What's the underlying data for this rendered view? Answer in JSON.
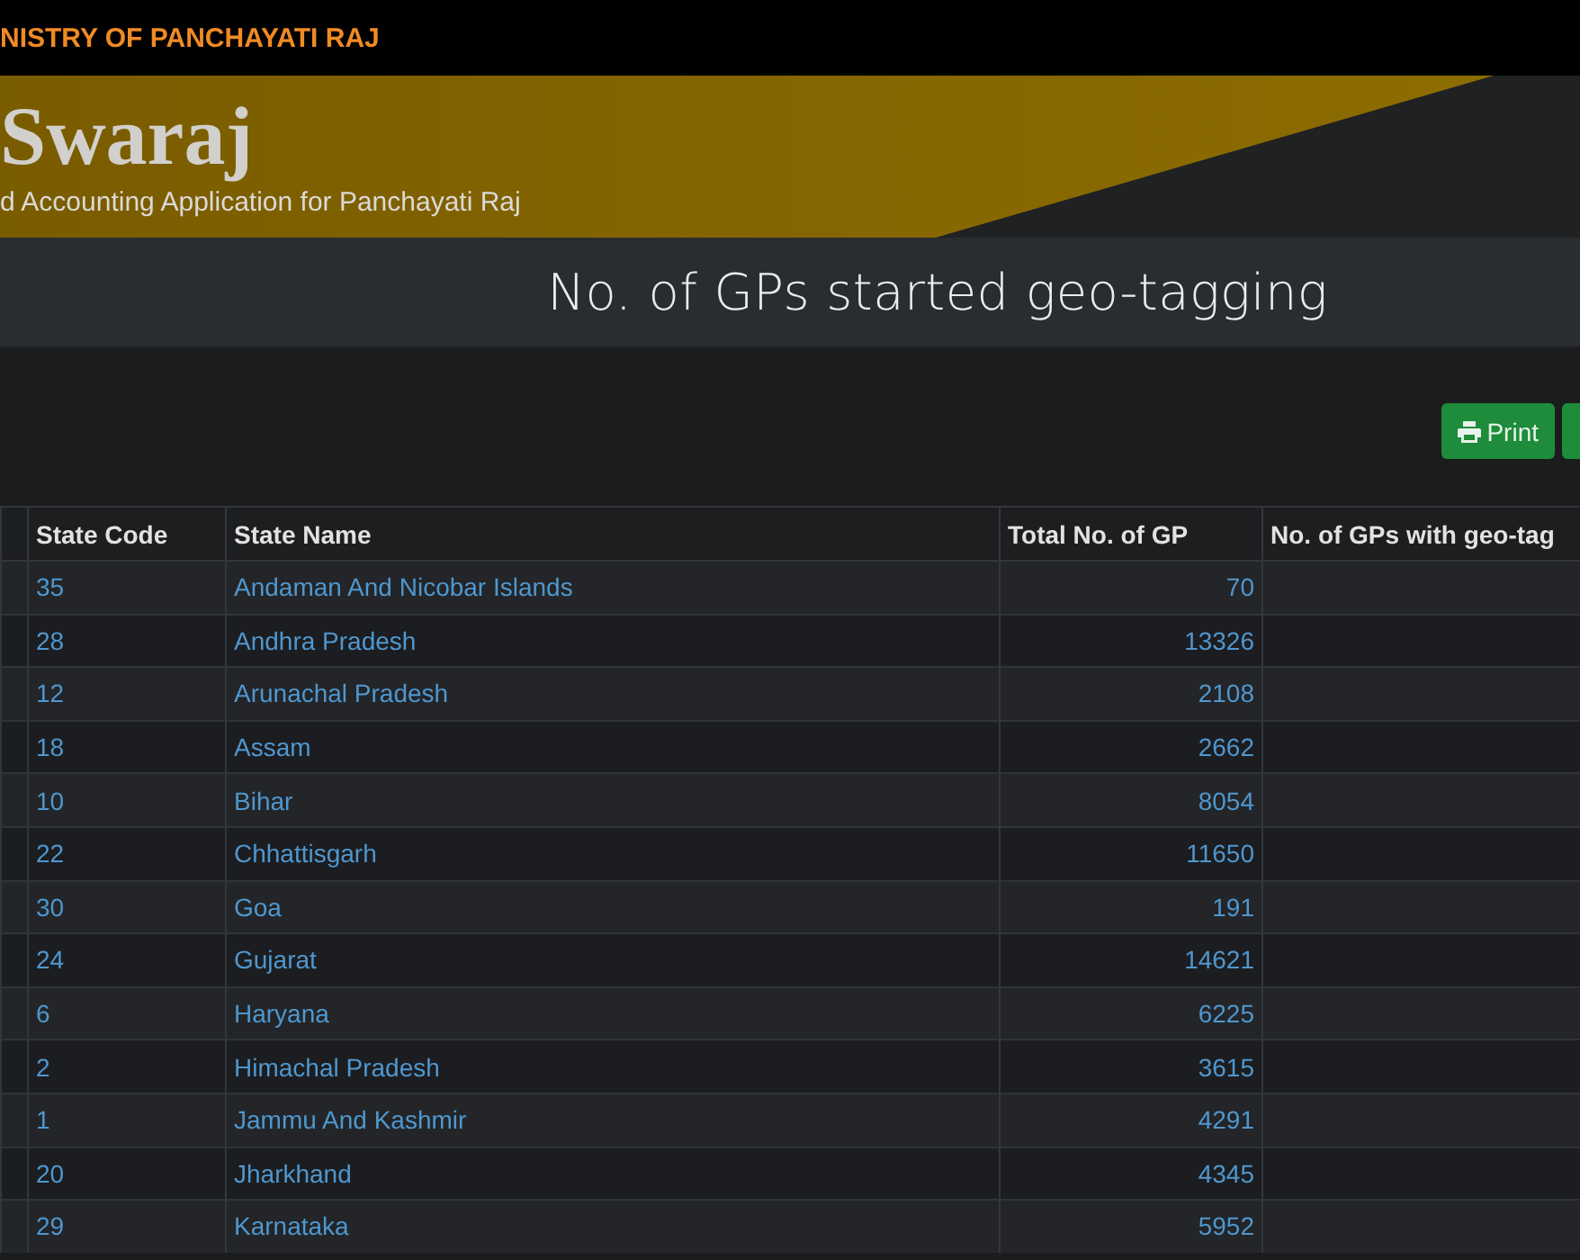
{
  "top_bar": {
    "title": "NISTRY OF PANCHAYATI RAJ"
  },
  "banner": {
    "title": "Swaraj",
    "subtitle": "d Accounting Application for Panchayati Raj"
  },
  "page_title": "No. of GPs started geo-tagging",
  "toolbar": {
    "print_button": {
      "label": "Print"
    }
  },
  "table": {
    "columns": [
      "State Code",
      "State Name",
      "Total No. of GP",
      "No. of GPs with geo-tag"
    ],
    "rows": [
      {
        "state_code": "35",
        "state_name": "Andaman And Nicobar Islands",
        "total": "70"
      },
      {
        "state_code": "28",
        "state_name": "Andhra Pradesh",
        "total": "13326"
      },
      {
        "state_code": "12",
        "state_name": "Arunachal Pradesh",
        "total": "2108"
      },
      {
        "state_code": "18",
        "state_name": "Assam",
        "total": "2662"
      },
      {
        "state_code": "10",
        "state_name": "Bihar",
        "total": "8054"
      },
      {
        "state_code": "22",
        "state_name": "Chhattisgarh",
        "total": "11650"
      },
      {
        "state_code": "30",
        "state_name": "Goa",
        "total": "191"
      },
      {
        "state_code": "24",
        "state_name": "Gujarat",
        "total": "14621"
      },
      {
        "state_code": "6",
        "state_name": "Haryana",
        "total": "6225"
      },
      {
        "state_code": "2",
        "state_name": "Himachal Pradesh",
        "total": "3615"
      },
      {
        "state_code": "1",
        "state_name": "Jammu And Kashmir",
        "total": "4291"
      },
      {
        "state_code": "20",
        "state_name": "Jharkhand",
        "total": "4345"
      },
      {
        "state_code": "29",
        "state_name": "Karnataka",
        "total": "5952"
      }
    ]
  }
}
